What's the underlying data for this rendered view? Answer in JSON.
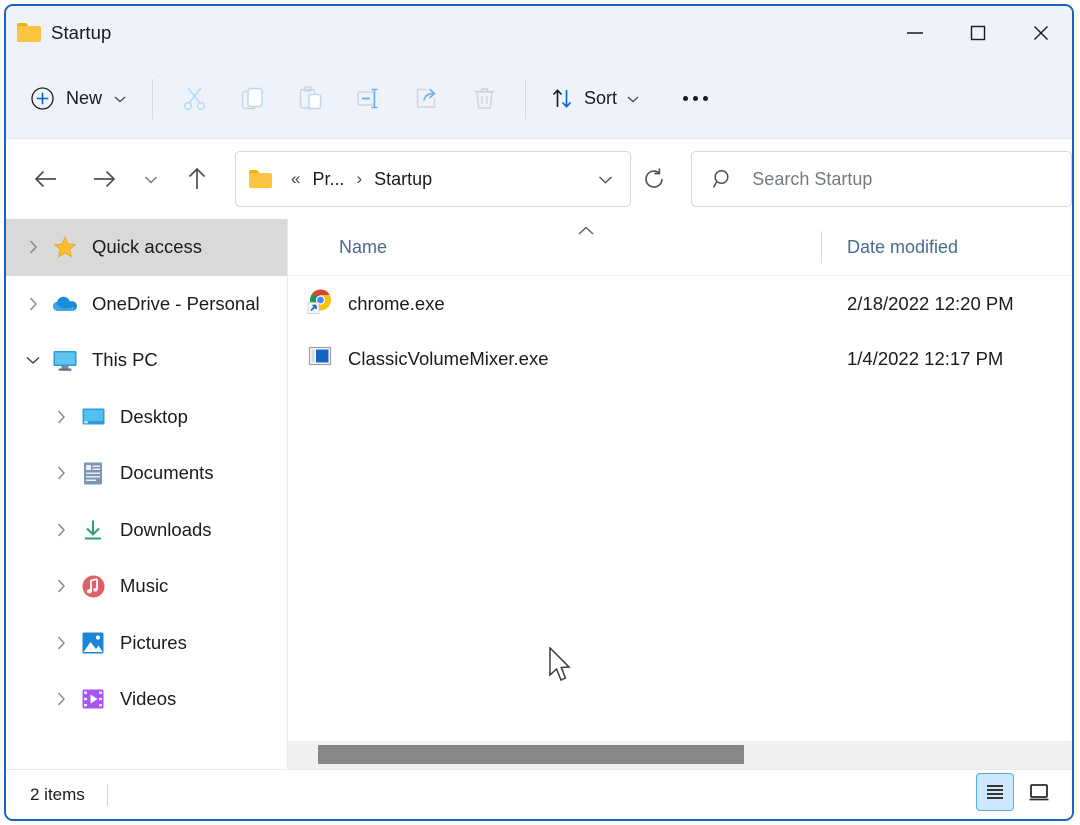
{
  "window": {
    "title": "Startup",
    "folder_icon": "folder-icon",
    "controls": {
      "minimize": "minimize-icon",
      "maximize": "maximize-icon",
      "close": "close-icon"
    }
  },
  "toolbar": {
    "new_label": "New",
    "new_icon": "plus-circle-icon",
    "new_chevron": "chevron-down-icon",
    "cut_icon": "scissors-icon",
    "copy_icon": "copy-icon",
    "paste_icon": "clipboard-icon",
    "rename_icon": "rename-icon",
    "share_icon": "share-icon",
    "delete_icon": "trash-icon",
    "sort_label": "Sort",
    "sort_icon": "sort-arrows-icon",
    "sort_chevron": "chevron-down-icon",
    "more_label": "See more"
  },
  "navigation": {
    "back_icon": "arrow-left-icon",
    "forward_icon": "arrow-right-icon",
    "recent_icon": "chevron-down-icon",
    "up_icon": "arrow-up-icon",
    "refresh_icon": "refresh-icon",
    "breadcrumb": {
      "folder_icon": "folder-icon",
      "overflow": "«",
      "separator": "›",
      "segments": [
        "Pr...",
        "Startup"
      ],
      "dropdown_icon": "chevron-down-icon"
    }
  },
  "search": {
    "icon": "search-icon",
    "placeholder": "Search Startup",
    "value": ""
  },
  "sidebar": {
    "items": [
      {
        "label": "Quick access",
        "icon": "star-icon",
        "expander": "chevron-right-icon",
        "selected": true,
        "indent": false
      },
      {
        "label": "OneDrive - Personal",
        "icon": "cloud-icon",
        "expander": "chevron-right-icon",
        "selected": false,
        "indent": false
      },
      {
        "label": "This PC",
        "icon": "monitor-icon",
        "expander": "chevron-down-icon",
        "selected": false,
        "indent": false
      },
      {
        "label": "Desktop",
        "icon": "desktop-icon",
        "expander": "chevron-right-icon",
        "selected": false,
        "indent": true
      },
      {
        "label": "Documents",
        "icon": "documents-icon",
        "expander": "chevron-right-icon",
        "selected": false,
        "indent": true
      },
      {
        "label": "Downloads",
        "icon": "downloads-icon",
        "expander": "chevron-right-icon",
        "selected": false,
        "indent": true
      },
      {
        "label": "Music",
        "icon": "music-icon",
        "expander": "chevron-right-icon",
        "selected": false,
        "indent": true
      },
      {
        "label": "Pictures",
        "icon": "pictures-icon",
        "expander": "chevron-right-icon",
        "selected": false,
        "indent": true
      },
      {
        "label": "Videos",
        "icon": "videos-icon",
        "expander": "chevron-right-icon",
        "selected": false,
        "indent": true
      }
    ]
  },
  "file_list": {
    "columns": [
      "Name",
      "Date modified"
    ],
    "sort_column": "Name",
    "sort_direction": "ascending",
    "sort_indicator_icon": "chevron-up-icon",
    "rows": [
      {
        "name": "chrome.exe",
        "date_modified": "2/18/2022 12:20 PM",
        "icon": "chrome-shortcut-icon"
      },
      {
        "name": "ClassicVolumeMixer.exe",
        "date_modified": "1/4/2022 12:17 PM",
        "icon": "application-icon"
      }
    ]
  },
  "status_bar": {
    "item_count": "2 items",
    "view_details_icon": "details-view-icon",
    "view_large_icons_icon": "large-icons-view-icon",
    "active_view": "details"
  },
  "colors": {
    "accent": "#1565c0",
    "toolbar_bg": "#eef2fa",
    "selection": "#d9d9d9",
    "column_header_text": "#4a6a93",
    "scrollbar_thumb": "#878787",
    "view_active_bg": "#cfe7fa"
  }
}
